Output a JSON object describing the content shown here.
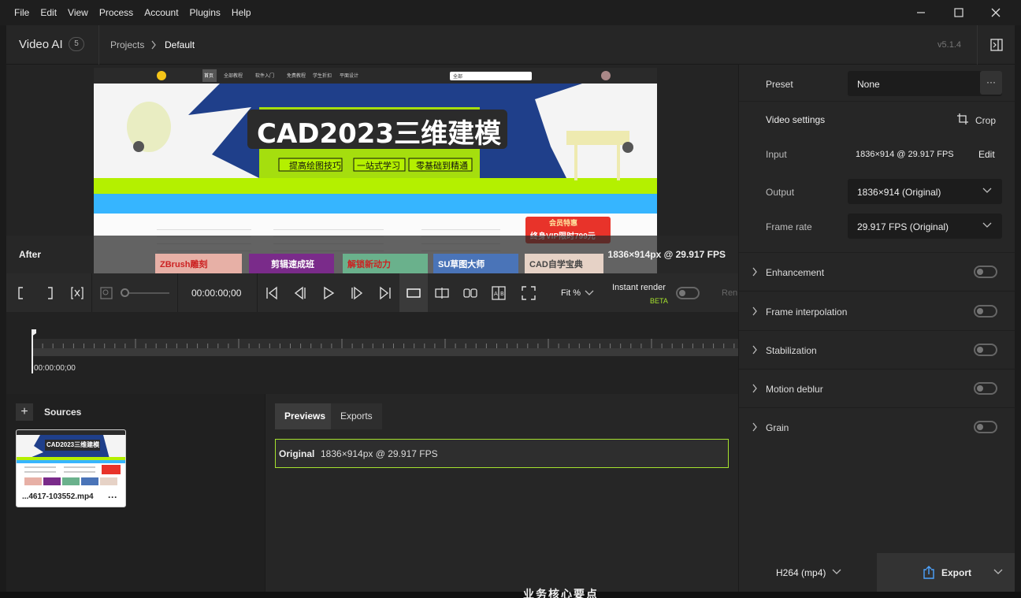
{
  "menu": [
    "File",
    "Edit",
    "View",
    "Process",
    "Account",
    "Plugins",
    "Help"
  ],
  "window_controls": {
    "minimize": "—",
    "maximize": "☐",
    "close": "✕"
  },
  "header": {
    "app_title": "Video AI",
    "badge": "5",
    "crumb_projects": "Projects",
    "crumb_current": "Default",
    "version": "v5.1.4"
  },
  "video": {
    "banner_title": "CAD2023三维建模",
    "pill1": "提高绘图技巧",
    "pill2": "一站式学习",
    "pill3": "零基础到精通",
    "nav_items": [
      "首页",
      "全部教程",
      "软件入门",
      "免费教程",
      "学生折扣",
      "平面设计"
    ],
    "search_placeholder": "全部",
    "promo_top": "会员特惠",
    "promo_bottom": "终身VIP限时799元",
    "cards": [
      "ZBrush雕刻",
      "剪辑速成班",
      "解锁新动力",
      "SU草图大师",
      "CAD自学宝典"
    ]
  },
  "preview": {
    "after_label": "After",
    "after_info": "1836×914px @ 29.917 FPS"
  },
  "toolbar": {
    "timecode": "00:00:00;00",
    "zoom": "Fit %",
    "instant_render": "Instant render",
    "beta": "BETA",
    "render_partial": "Ren"
  },
  "timeline": {
    "start_time": "00:00:00;00"
  },
  "sources": {
    "title": "Sources",
    "add": "+",
    "file_name": "...4617-103552.mp4",
    "more": "···",
    "thumb_title": "CAD2023三维建模"
  },
  "previews_panel": {
    "tab_previews": "Previews",
    "tab_exports": "Exports",
    "original_label": "Original",
    "original_info": "1836×914px @ 29.917 FPS"
  },
  "right_panel": {
    "preset_label": "Preset",
    "preset_value": "None",
    "more": "···",
    "video_settings": "Video settings",
    "crop": "Crop",
    "input_label": "Input",
    "input_value": "1836×914 @ 29.917 FPS",
    "edit": "Edit",
    "output_label": "Output",
    "output_value": "1836×914 (Original)",
    "framerate_label": "Frame rate",
    "framerate_value": "29.917 FPS (Original)",
    "sections": [
      "Enhancement",
      "Frame interpolation",
      "Stabilization",
      "Motion deblur",
      "Grain"
    ],
    "codec": "H264 (mp4)",
    "export": "Export"
  },
  "background_text": "业务核心要点",
  "colors": {
    "accent": "#a6e22e",
    "panel": "#262626",
    "beta": "#a6e22e"
  }
}
